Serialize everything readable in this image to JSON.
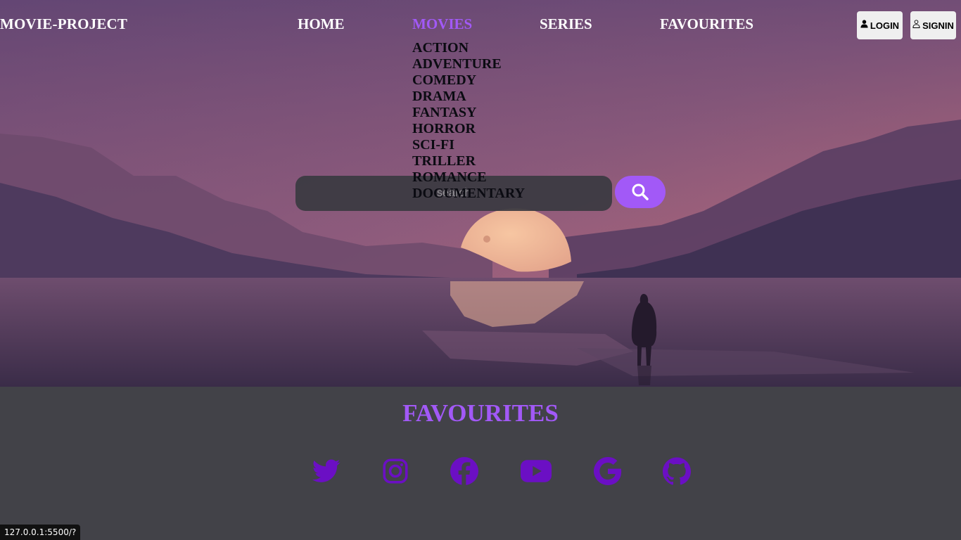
{
  "brand": {
    "title": "MOVIE-PROJECT"
  },
  "nav": {
    "home": "HOME",
    "movies": "MOVIES",
    "series": "SERIES",
    "favourites": "FAVOURITES"
  },
  "auth": {
    "login": "LOGIN",
    "signin": "SIGNIN"
  },
  "dropdown": {
    "items": [
      "ACTION",
      "ADVENTURE",
      "COMEDY",
      "DRAMA",
      "FANTASY",
      "HORROR",
      "SCI-FI",
      "TRILLER",
      "ROMANCE",
      "DOCUMENTARY"
    ]
  },
  "search": {
    "placeholder": "search"
  },
  "footer": {
    "title": "FAVOURITES",
    "socials": [
      "twitter-icon",
      "instagram-icon",
      "facebook-icon",
      "youtube-icon",
      "google-icon",
      "github-icon"
    ]
  },
  "status": {
    "url": "127.0.0.1:5500/?"
  },
  "colors": {
    "accent": "#a259f7",
    "footer_bg": "#424248",
    "social_icon": "#6b0fc4"
  }
}
